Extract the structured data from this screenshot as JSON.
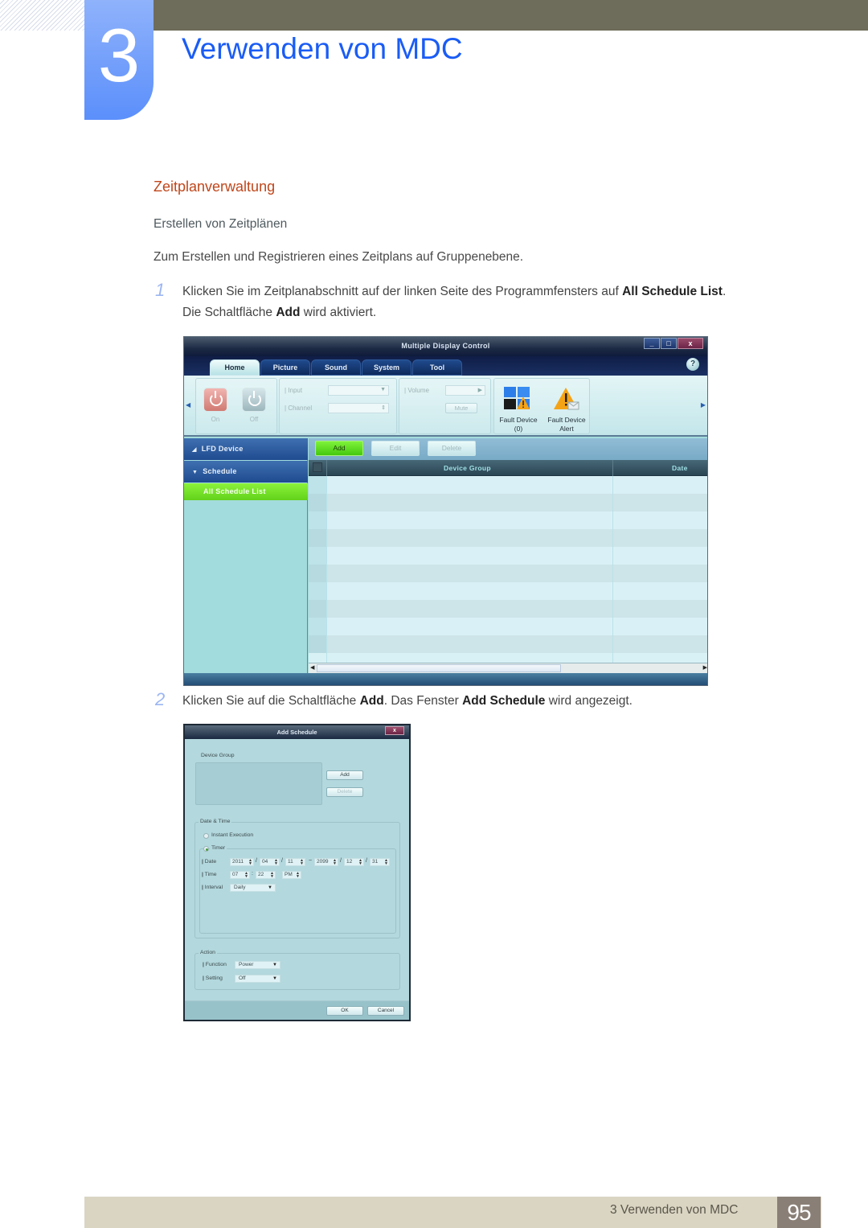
{
  "header": {
    "chapter_number": "3",
    "chapter_title": "Verwenden von MDC"
  },
  "section": {
    "title": "Zeitplanverwaltung",
    "subtitle": "Erstellen von Zeitplänen",
    "intro": "Zum Erstellen und Registrieren eines Zeitplans auf Gruppenebene."
  },
  "steps": [
    {
      "number": "1",
      "line1_a": "Klicken Sie im Zeitplanabschnitt auf der linken Seite des Programmfensters auf ",
      "line1_b": "All Schedule List",
      "line1_c": ".",
      "line2_a": "Die Schaltfläche ",
      "line2_b": "Add",
      "line2_c": " wird aktiviert."
    },
    {
      "number": "2",
      "line1_a": "Klicken Sie auf die Schaltfläche ",
      "line1_b": "Add",
      "line1_c": ". Das Fenster ",
      "line1_d": "Add Schedule",
      "line1_e": " wird angezeigt."
    }
  ],
  "mdc_window": {
    "title": "Multiple Display Control",
    "window_buttons": {
      "minimize": "_",
      "maximize": "□",
      "close": "x"
    },
    "tabs": [
      {
        "label": "Home",
        "active": true
      },
      {
        "label": "Picture",
        "active": false
      },
      {
        "label": "Sound",
        "active": false
      },
      {
        "label": "System",
        "active": false
      },
      {
        "label": "Tool",
        "active": false
      }
    ],
    "help": "?",
    "ribbon": {
      "power_on_label": "On",
      "power_off_label": "Off",
      "input_label": "Input",
      "channel_label": "Channel",
      "volume_label": "Volume",
      "mute_label": "Mute",
      "fault_device_label": "Fault Device",
      "fault_device_count": "(0)",
      "fault_alert_label": "Fault Device",
      "fault_alert_sub": "Alert"
    },
    "sidebar": {
      "lfd_device": "LFD Device",
      "schedule": "Schedule",
      "selected_item": "All Schedule List"
    },
    "toolbar": {
      "add": "Add",
      "edit": "Edit",
      "delete": "Delete"
    },
    "grid": {
      "columns": [
        "Device Group",
        "Date"
      ],
      "rows": 10
    },
    "colors": {
      "add_green": "#5ad81e",
      "sidebar_selected": "#7ee82e",
      "header_blue": "#1f4b90"
    }
  },
  "add_schedule": {
    "title": "Add Schedule",
    "close": "x",
    "device_group_label": "Device Group",
    "add_button": "Add",
    "delete_button": "Delete",
    "date_time_legend": "Date & Time",
    "instant_execution": "Instant Execution",
    "timer_legend": "Timer",
    "date_label": "Date",
    "date_from": {
      "year": "2011",
      "month": "04",
      "day": "11"
    },
    "date_tilde": "~",
    "date_to": {
      "year": "2099",
      "month": "12",
      "day": "31"
    },
    "slash": "/",
    "time_label": "Time",
    "time": {
      "hour": "07",
      "minute": "22",
      "ampm": "PM"
    },
    "colon": ":",
    "interval_label": "Interval",
    "interval_value": "Daily",
    "action_legend": "Action",
    "function_label": "Function",
    "function_value": "Power",
    "setting_label": "Setting",
    "setting_value": "Off",
    "ok": "OK",
    "cancel": "Cancel"
  },
  "footer": {
    "chapter_ref": "3 Verwenden von MDC",
    "page_number": "95"
  }
}
